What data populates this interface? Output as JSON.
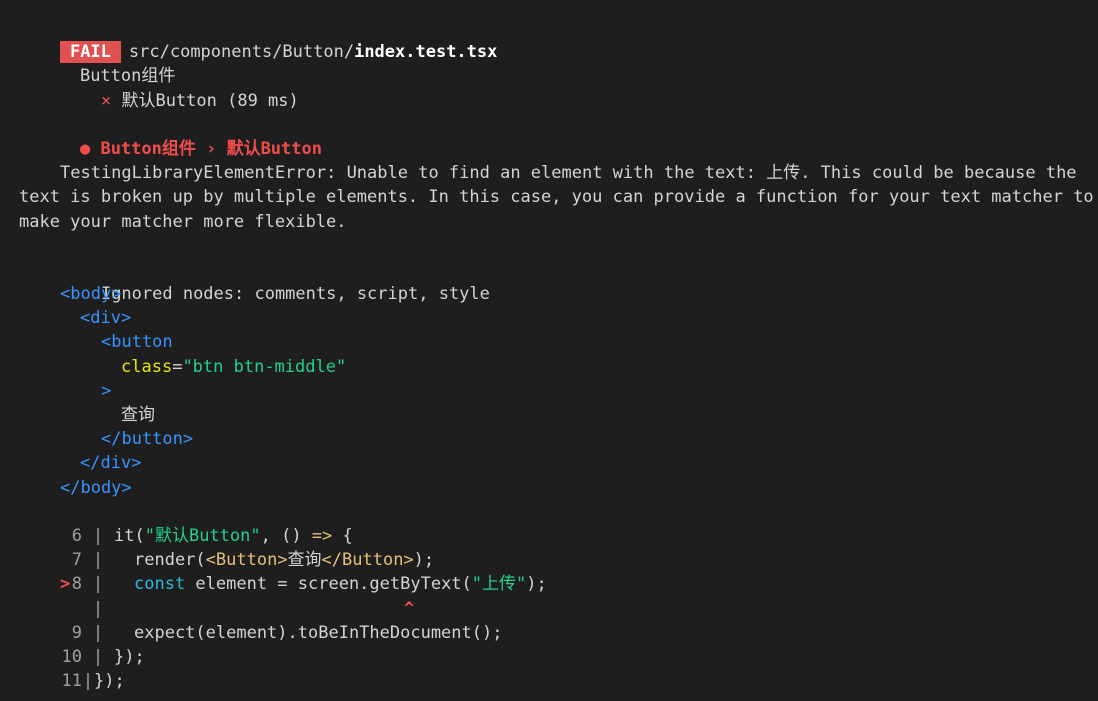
{
  "header": {
    "badge": "FAIL",
    "path_prefix": "src/components/Button/",
    "path_file": "index.test.tsx"
  },
  "suite": {
    "name": "Button组件",
    "test_mark": "×",
    "test_name": "默认Button (89 ms)"
  },
  "failure": {
    "bullet": "●",
    "title": "Button组件 › 默认Button"
  },
  "error": {
    "message": "TestingLibraryElementError: Unable to find an element with the text: 上传. This could be because the text is broken up by multiple elements. In this case, you can provide a function for your text matcher to make your matcher more flexible.",
    "ignored": "Ignored nodes: comments, script, style"
  },
  "dom": {
    "body_open": "<body>",
    "div_open": "<div>",
    "button_open": "<button",
    "attr_name": "class",
    "attr_eq": "=",
    "attr_value": "\"btn btn-middle\"",
    "gt": ">",
    "text": "查询",
    "button_close": "</button>",
    "div_close": "</div>",
    "body_close": "</body>"
  },
  "code": {
    "l6_num": "6",
    "l6_a": "it(",
    "l6_str": "\"默认Button\"",
    "l6_b": ", () ",
    "l6_arrow": "=>",
    "l6_c": " {",
    "l7_num": "7",
    "l7_a": "render(",
    "l7_tag_open": "<Button>",
    "l7_text": "查询",
    "l7_tag_close": "</Button>",
    "l7_b": ");",
    "l8_marker": ">",
    "l8_num": "8",
    "l8_kw": "const",
    "l8_a": " element = screen.",
    "l8_fn": "getByText",
    "l8_b": "(",
    "l8_str": "\"上传\"",
    "l8_c": ");",
    "caret": "^",
    "l9_num": "9",
    "l9_a": "expect(element).",
    "l9_fn": "toBeInTheDocument",
    "l9_b": "();",
    "l10_num": "10",
    "l10_a": "});",
    "l11_num": "11",
    "l11_a": "});",
    "bar": "|"
  },
  "colors": {
    "background": "#1e1e1e",
    "fail_badge": "#e05252",
    "error_red": "#f14c4c",
    "tag_blue": "#3794ff",
    "attr_yellow": "#e5e510",
    "string_green": "#23d18b"
  }
}
